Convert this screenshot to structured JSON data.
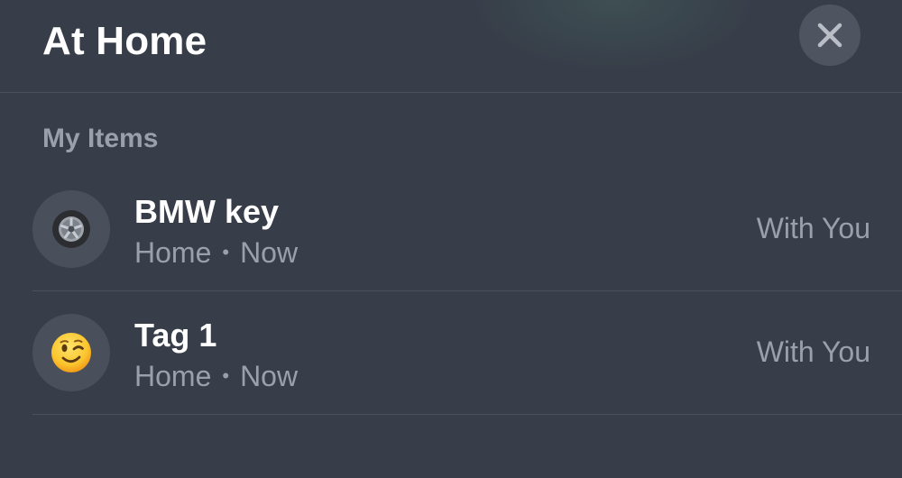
{
  "header": {
    "title": "At Home",
    "close_icon": "close-icon"
  },
  "section": {
    "title": "My Items"
  },
  "items": [
    {
      "name": "BMW key",
      "location": "Home",
      "separator": "•",
      "time": "Now",
      "status": "With You",
      "icon": "wheel-icon"
    },
    {
      "name": "Tag 1",
      "location": "Home",
      "separator": "•",
      "time": "Now",
      "status": "With You",
      "icon": "winking-face-icon"
    }
  ],
  "colors": {
    "background": "#373e49",
    "secondary_text": "#9aa0aa",
    "button_fill": "#4e5560"
  }
}
